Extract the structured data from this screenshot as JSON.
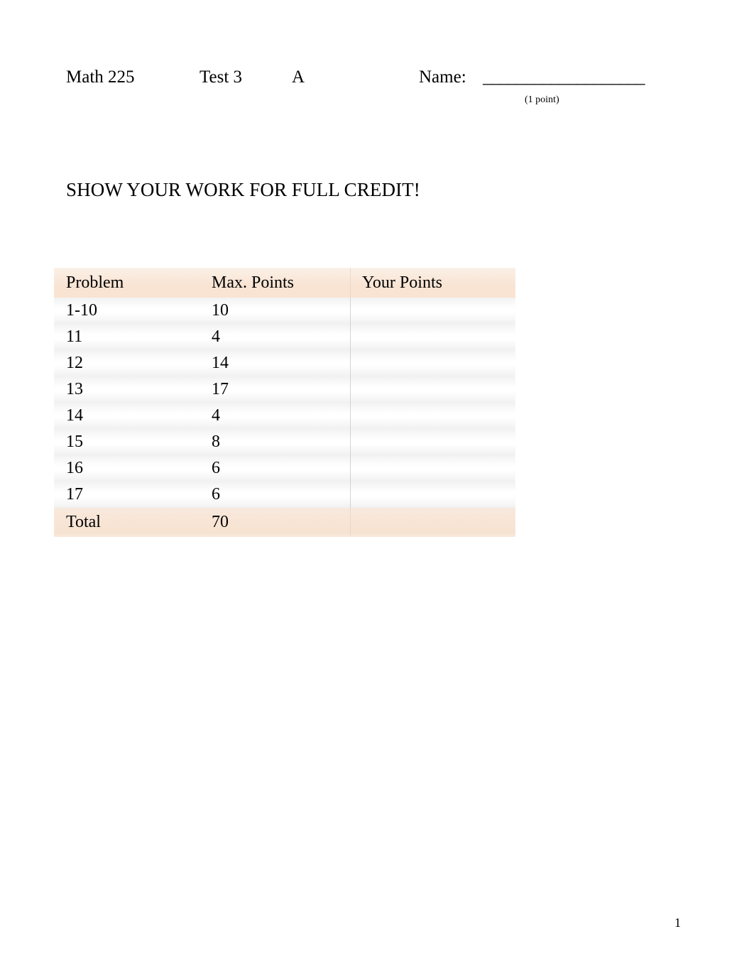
{
  "header": {
    "course": "Math 225",
    "test": "Test 3",
    "version": "A",
    "name_label": "Name:",
    "name_rule": "___________________",
    "points_note": "(1 point)"
  },
  "instructions": {
    "show_work": "SHOW YOUR WORK FOR FULL CREDIT!"
  },
  "score_table": {
    "columns": [
      "Problem",
      "Max. Points",
      "Your Points"
    ],
    "rows": [
      {
        "problem": "1-10",
        "max_points": "10",
        "your_points": ""
      },
      {
        "problem": "11",
        "max_points": "4",
        "your_points": ""
      },
      {
        "problem": "12",
        "max_points": "14",
        "your_points": ""
      },
      {
        "problem": "13",
        "max_points": "17",
        "your_points": ""
      },
      {
        "problem": "14",
        "max_points": "4",
        "your_points": ""
      },
      {
        "problem": "15",
        "max_points": "8",
        "your_points": ""
      },
      {
        "problem": "16",
        "max_points": "6",
        "your_points": ""
      },
      {
        "problem": "17",
        "max_points": "6",
        "your_points": ""
      }
    ],
    "total": {
      "problem": "Total",
      "max_points": "70",
      "your_points": ""
    }
  },
  "footer": {
    "page_number": "1"
  },
  "colors": {
    "header_band": "#f9e4d3",
    "total_band": "#f8e4d4",
    "row_band": "#f1f1f1",
    "text": "#000000",
    "page_background": "#ffffff"
  }
}
